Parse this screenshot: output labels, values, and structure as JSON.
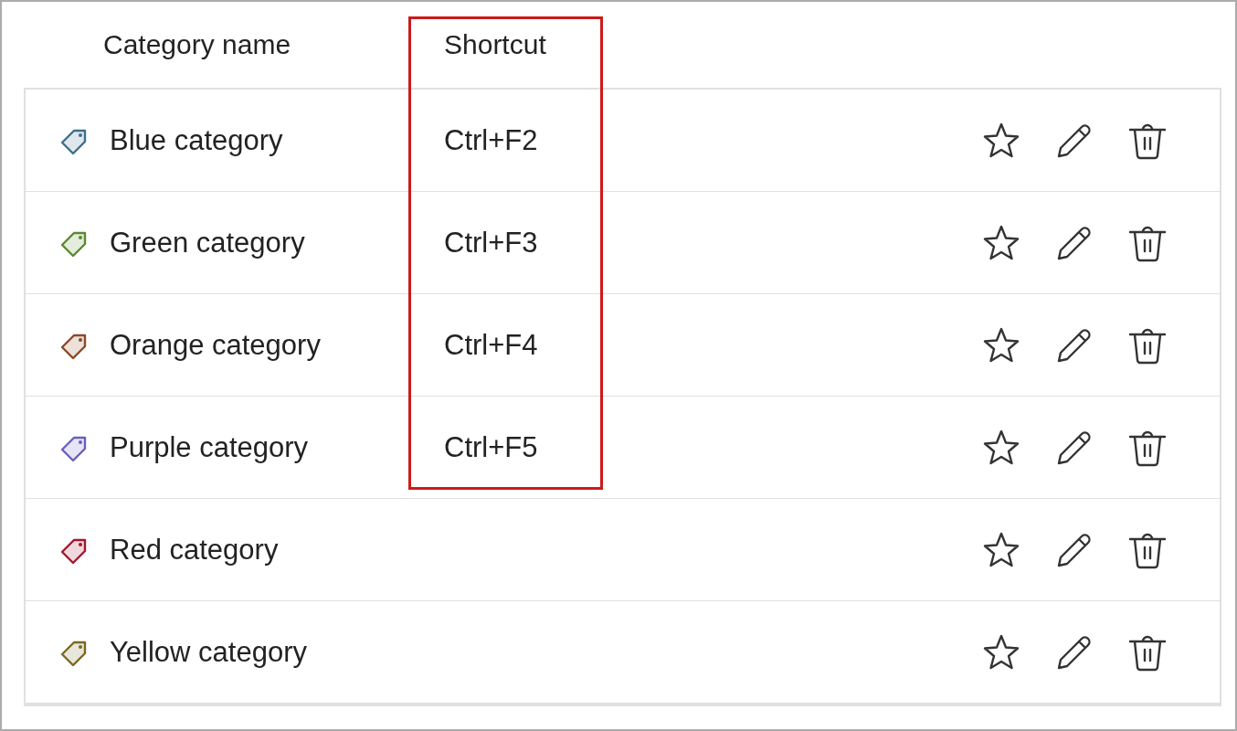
{
  "columns": [
    "Category name",
    "Shortcut"
  ],
  "categories": [
    {
      "name": "Blue category",
      "shortcut": "Ctrl+F2",
      "color": "#3f6e8c"
    },
    {
      "name": "Green category",
      "shortcut": "Ctrl+F3",
      "color": "#5a8a2e"
    },
    {
      "name": "Orange category",
      "shortcut": "Ctrl+F4",
      "color": "#8a4a26"
    },
    {
      "name": "Purple category",
      "shortcut": "Ctrl+F5",
      "color": "#6a5fc0"
    },
    {
      "name": "Red category",
      "color": "#a0182e"
    },
    {
      "name": "Yellow category",
      "color": "#7a6a20"
    }
  ]
}
